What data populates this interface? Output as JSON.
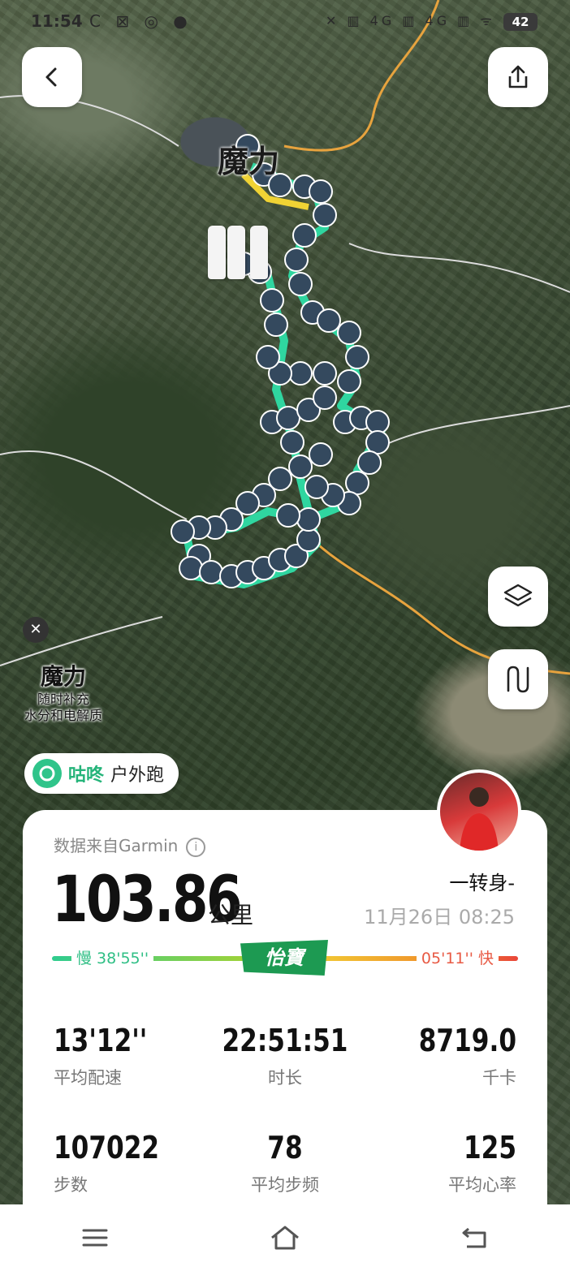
{
  "status_bar": {
    "time": "11:54",
    "status_icons": "C ⊠ ◎ ●",
    "network": "✕ ▥ 4G ▥ 4G ▥ ᯤ",
    "battery": "42"
  },
  "map": {
    "place_label": "魔力",
    "ad": {
      "title": "魔力",
      "line1": "随时补充",
      "line2": "水分和电解质"
    },
    "colors": {
      "route": "#2fd6a0",
      "marker": "#34495e",
      "road": "#e7a33e"
    }
  },
  "app": {
    "name": "咕咚",
    "activity_type": "户外跑"
  },
  "card": {
    "source_text": "数据来自Garmin",
    "info_icon": "i",
    "distance": "103.86",
    "distance_unit": "公里",
    "username": "一转身-",
    "datetime": "11月26日 08:25",
    "pace_slow": "慢 38'55''",
    "pace_fast": "05'11'' 快",
    "sponsor": "怡寶",
    "stats": [
      {
        "value": "13'12''",
        "label": "平均配速"
      },
      {
        "value": "22:51:51",
        "label": "时长"
      },
      {
        "value": "8719.0",
        "label": "千卡"
      },
      {
        "value": "107022",
        "label": "步数"
      },
      {
        "value": "78",
        "label": "平均步频"
      },
      {
        "value": "125",
        "label": "平均心率"
      }
    ]
  },
  "icons": [
    "back-icon",
    "share-icon",
    "layers-icon",
    "route-toggle-icon",
    "menu-icon",
    "home-icon",
    "back-nav-icon",
    "close-icon"
  ]
}
